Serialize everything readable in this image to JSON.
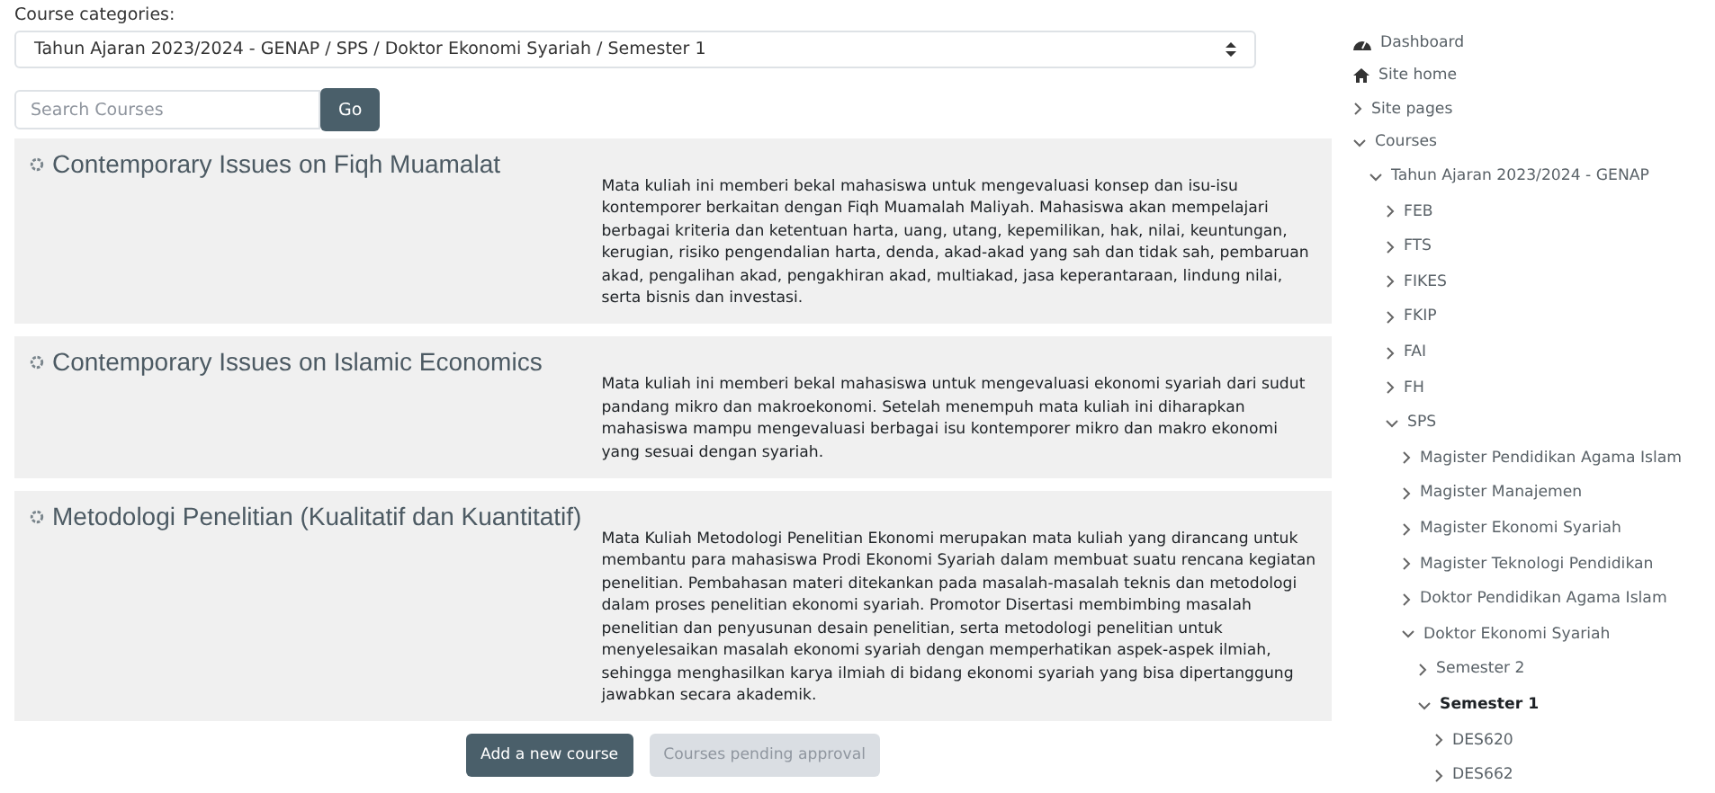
{
  "category_select": {
    "label": "Course categories:",
    "value": "Tahun Ajaran 2023/2024 - GENAP / SPS / Doktor Ekonomi Syariah / Semester 1"
  },
  "search": {
    "placeholder": "Search Courses",
    "button": "Go"
  },
  "courses": [
    {
      "title": "Contemporary Issues on Fiqh Muamalat",
      "summary": "Mata kuliah ini memberi bekal mahasiswa untuk mengevaluasi konsep dan isu-isu kontemporer berkaitan dengan Fiqh Muamalah Maliyah. Mahasiswa akan mempelajari berbagai kriteria dan ketentuan harta, uang, utang, kepemilikan, hak, nilai, keuntungan, kerugian, risiko pengendalian harta, denda, akad-akad yang sah dan tidak sah, pembaruan akad, pengalihan akad, pengakhiran akad, multiakad, jasa keperantaraan, lindung nilai, serta bisnis dan investasi."
    },
    {
      "title": "Contemporary Issues on Islamic Economics",
      "summary": "Mata kuliah ini memberi bekal mahasiswa untuk mengevaluasi ekonomi syariah dari sudut pandang mikro dan makroekonomi. Setelah menempuh mata kuliah ini diharapkan mahasiswa mampu mengevaluasi berbagai isu kontemporer mikro dan makro ekonomi yang sesuai dengan syariah."
    },
    {
      "title": "Metodologi Penelitian (Kualitatif dan Kuantitatif)",
      "summary": "Mata Kuliah Metodologi Penelitian Ekonomi merupakan mata kuliah yang dirancang untuk membantu para mahasiswa Prodi Ekonomi Syariah dalam membuat suatu rencana kegiatan penelitian. Pembahasan materi ditekankan pada masalah-masalah teknis dan metodologi dalam proses penelitian ekonomi syariah. Promotor Disertasi membimbing  masalah penelitian dan penyusunan desain penelitian, serta metodologi penelitian untuk menyelesaikan masalah  ekonomi syariah dengan memperhatikan aspek-aspek ilmiah, sehingga menghasilkan karya ilmiah di bidang ekonomi syariah yang bisa dipertanggung jawabkan secara akademik."
    }
  ],
  "buttons": [
    {
      "label": "Add a new course",
      "disabled": false
    },
    {
      "label": "Courses pending approval",
      "disabled": true
    }
  ],
  "navigation": [
    {
      "label": "Dashboard",
      "kind": "dashboard",
      "selected": false
    },
    {
      "label": "Site home",
      "kind": "home",
      "selected": false
    },
    {
      "label": "Site pages",
      "kind": "node",
      "expanded": false,
      "selected": false
    },
    {
      "label": "Courses",
      "kind": "node",
      "expanded": true,
      "selected": false,
      "children": [
        {
          "label": "Tahun Ajaran 2023/2024 - GENAP",
          "kind": "node",
          "expanded": true,
          "selected": false,
          "children": [
            {
              "label": "FEB",
              "kind": "node",
              "expanded": false,
              "selected": false
            },
            {
              "label": "FTS",
              "kind": "node",
              "expanded": false,
              "selected": false
            },
            {
              "label": "FIKES",
              "kind": "node",
              "expanded": false,
              "selected": false
            },
            {
              "label": "FKIP",
              "kind": "node",
              "expanded": false,
              "selected": false
            },
            {
              "label": "FAI",
              "kind": "node",
              "expanded": false,
              "selected": false
            },
            {
              "label": "FH",
              "kind": "node",
              "expanded": false,
              "selected": false
            },
            {
              "label": "SPS",
              "kind": "node",
              "expanded": true,
              "selected": false,
              "children": [
                {
                  "label": "Magister Pendidikan Agama Islam",
                  "kind": "node",
                  "expanded": false,
                  "selected": false
                },
                {
                  "label": "Magister Manajemen",
                  "kind": "node",
                  "expanded": false,
                  "selected": false
                },
                {
                  "label": "Magister Ekonomi Syariah",
                  "kind": "node",
                  "expanded": false,
                  "selected": false
                },
                {
                  "label": "Magister Teknologi Pendidikan",
                  "kind": "node",
                  "expanded": false,
                  "selected": false
                },
                {
                  "label": "Doktor Pendidikan Agama Islam",
                  "kind": "node",
                  "expanded": false,
                  "selected": false
                },
                {
                  "label": "Doktor Ekonomi Syariah",
                  "kind": "node",
                  "expanded": true,
                  "selected": false,
                  "children": [
                    {
                      "label": "Semester 2",
                      "kind": "node",
                      "expanded": false,
                      "selected": false
                    },
                    {
                      "label": "Semester 1",
                      "kind": "node",
                      "expanded": true,
                      "selected": true,
                      "children": [
                        {
                          "label": "DES620",
                          "kind": "node",
                          "expanded": false,
                          "selected": false
                        },
                        {
                          "label": "DES662",
                          "kind": "node",
                          "expanded": false,
                          "selected": false
                        }
                      ]
                    }
                  ]
                }
              ]
            }
          ]
        }
      ]
    }
  ]
}
